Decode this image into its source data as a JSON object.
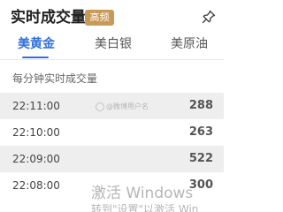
{
  "header": {
    "title": "实时成交量",
    "badge": "高频",
    "pin_icon": "pin-icon"
  },
  "tabs": [
    {
      "label": "美黄金",
      "active": true
    },
    {
      "label": "美白银",
      "active": false
    },
    {
      "label": "美原油",
      "active": false
    }
  ],
  "subtitle": "每分钟实时成交量",
  "rows": [
    {
      "time": "22:11:00",
      "volume": "288"
    },
    {
      "time": "22:10:00",
      "volume": "263"
    },
    {
      "time": "22:09:00",
      "volume": "522"
    },
    {
      "time": "22:08:00",
      "volume": "300"
    }
  ],
  "watermarks": {
    "weibo": "@微博用户名",
    "windows_line1": "激活 Windows",
    "windows_line2": "转到\"设置\"以激活 Win"
  },
  "colors": {
    "accent": "#2f6fdf",
    "badge": "#c89a55",
    "row_shade": "#eeeeee"
  }
}
